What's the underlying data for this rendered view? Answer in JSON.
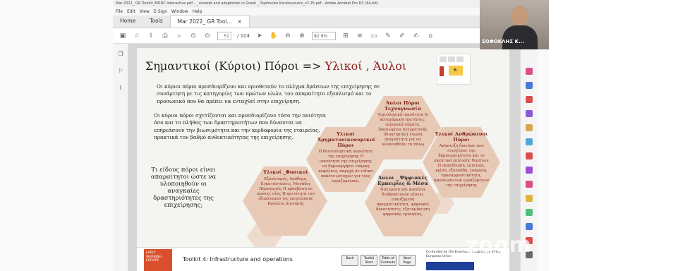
{
  "window": {
    "title": "Mar 2022_ GR Toolkit_MODC interactive pdf - _ excerpt and adaptation in Greek _ Sophocles Karakovounis_v2 25.pdf - Adobe Acrobat Pro DC (64-bit)"
  },
  "menu": [
    "File",
    "Edit",
    "View",
    "E-Sign",
    "Window",
    "Help"
  ],
  "tabs": {
    "home": "Home",
    "tools": "Tools",
    "doc": "Mar 2022_ GR Tool...",
    "doc_close": "×"
  },
  "toolbar": {
    "page_current": "51",
    "page_total": "/ 104",
    "zoom": "82.9%"
  },
  "webcam": {
    "participant_name": "ΣΟΦΟΚΛΗΣ Κ..."
  },
  "zoom_watermark": "zoom",
  "slide": {
    "title_main": "Σημαντικοί (Κύριοι) Πόροι => ",
    "title_highlight": "Υλικοί , Άυλοι",
    "para1": "Οι κύριοι πόροι προσδιορίζουν και οριοθετούν το πλέγμα δράσεων της επιχείρησης σε συνάρτηση με τις κατηγορίες των πρώτων υλών, τον απαραίτητο εξοπλισμό και το προσωπικό που θα πρέπει να ενταχθεί στην επιχείρηση.",
    "para2": "Οι κύριοι πόροι σχετίζονται και προσδιορίζουν τόσο την ποιότητα όσο και το πλήθος των δραστηριοτήτων που δύνανται να επηρεάσουν την βιωσιμότητα και την κερδοφορία της εταιρείας, πρακτικά τον βαθμό ανθεκτικότητας της επιχείρησης.",
    "left_heading": "Τι είδους πόροι είναι απαραίτητοι ώστε να υλοποιηθούν οι αναγκαίες δραστηριότητες της επιχείρησης;",
    "hex_physical_title": "Υλικοί _Φυσικοί",
    "hex_physical_text": "Εξοπλισμός, Απόθεμα, Εγκαταστάσεις, Μονάδες Παραγωγής Η πρόσβαση σε πρώτες ύλες Η αρτιότητα του εξοπλισμού της επιχείρησης Κανάλια Διανομής",
    "hex_financial_title": "Υλικοί Χρηματοοικονομικοί Πόροι",
    "hex_financial_text": "Η δανειοληπτική ικανότητα της επιχείρησης Η ικανότητα της επιχείρησης να δημιουργήσει επαρκή κεφάλαια, παροχή σε ειδικά πακέτα μετοχών για τους εργαζομένους.",
    "hex_tech_title": "Άυλοι Πόροι Τεχνογνωσία",
    "hex_tech_text": "Τεχνολογική ικανότητα & κατοχύρωση (πατέντες, εμπορικά σήματα, δικαιώματα πνευματικής ιδιοκτησίας) Γνώση απαραίτητη για να υλοποιηθούν τα πάνω",
    "hex_digital_title": "Άυλοι _ Ψηφιακές Εμπειρίες & Μέσα",
    "hex_digital_text": "Πολυμέσα και κανάλια διαδραστικών μέσων, επαυξημένη πραγματικότητα, ψηφιακές δυνατότητες, εξατομίκευση ψηφιακής εμπειρίας.",
    "hex_human_title": "Υλικοί Ανθρώπινοι Πόροι",
    "hex_human_text": "Ανάπτυξη δικτύων που ενισχύουν την δημιουργικότητα και το σκεπτικό επίλυσης θεμάτων Η εκπαίδευση, εμπειρία, κρίση, εξυπνάδα, ενόραση, προσαρμοστικότητα, αφοσίωση των εργαζομένων της επιχείρησης",
    "card_label": "6."
  },
  "footer": {
    "logo_text": "EARLY WARNING EUROPE",
    "toolkit_label": "Toolkit 4: Infrastructure and operations",
    "btn_back": "Back",
    "btn_start": "Toolkit Start",
    "btn_contents": "Table of Contents",
    "btn_next": "Next Page",
    "eu_text": "Co-funded by the Erasmus+ Programme of the European Union"
  },
  "colors": {
    "accent": "#8b1a1a",
    "hex_fill": "#e7c9b6",
    "logo": "#d94f2b"
  }
}
